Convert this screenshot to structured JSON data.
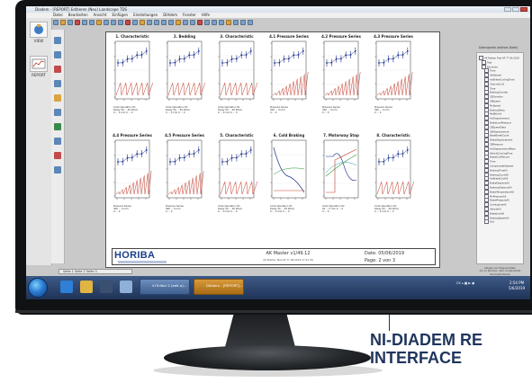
{
  "window": {
    "app_title": "Diadem - [REPORT]   Editieren (Neu)   Landscape TDS",
    "menu": [
      "Datei",
      "Bearbeiten",
      "Ansicht",
      "Einfügen",
      "Einstellungen",
      "DIAdem",
      "Fenster",
      "Hilfe"
    ]
  },
  "left_panel": {
    "view_label": "VIEW",
    "report_label": "REPORT"
  },
  "report": {
    "charts": [
      {
        "title": "1. Characteristic",
        "caption": "Code Operation Hz\nDelay 50 ... 56 kHz/s\n0 ... 0 mm  0 ... 0"
      },
      {
        "title": "2. Bedding",
        "caption": "Code Operation Hz\nDelay 50 ... 56 kHz/s\n0 ... 0 mm  0 ... 0"
      },
      {
        "title": "3. Characteristic",
        "caption": "Code Operation Hz\nDelay 50 ... 56 kHz/s\n0 ... 0 mm  0 ... 0"
      },
      {
        "title": "4.1 Pressure Series",
        "caption": "Pressure Series\n300 ... 0 mm\n0 ... 0"
      },
      {
        "title": "4.2 Pressure Series",
        "caption": "Pressure Series\n300 ... 0 mm\n0 ... 0"
      },
      {
        "title": "4.3 Pressure Series",
        "caption": "Pressure Series\n300 ... 0 mm\n0 ... 0"
      },
      {
        "title": "4.4 Pressure Series",
        "caption": "Pressure Series\n300 ... 0 mm\n0 ... 0"
      },
      {
        "title": "4.5 Pressure Series",
        "caption": "Pressure Series\n300 ... 0 mm\n0 ... 0"
      },
      {
        "title": "5. Characteristic",
        "caption": "Code Operation Hz\nDelay 50 ... 56 kHz/s\n0 ... 0 mm  0 ... 0"
      },
      {
        "title": "6. Cold Braking",
        "caption": "Code Operation Hz\nDelay 50 ... 56 kHz/s\n0 ... 0 mm  0 ... 0"
      },
      {
        "title": "7. Motorway Stop",
        "caption": "Code Operation Hz\n20 ... 0 mm  0 ... 0\n0 ... 0"
      },
      {
        "title": "8. Characteristic",
        "caption": "Code Operation Hz\nDelay 50 ... 56 kHz/s\n0 ... 0 mm  0 ... 0"
      }
    ],
    "footer": {
      "logo": "HORIBA",
      "center_title": "AK Master v1/49.12",
      "center_sub": "AK Master Test AP 77 06.2019 17:21:39",
      "date": "Date: 05/06/2019",
      "page": "Page: 2 von 3"
    },
    "page_tab": "Seite  1  Seite 2  Seite 3"
  },
  "right_panel": {
    "title": "Datenportal (aktives Datei)",
    "tree": [
      "AK Master Test AP 77 06.2019",
      "Test",
      "Kennlinie",
      "Time",
      "VehSpeed",
      "AvlBrakeCoolingTime",
      "Channels 16",
      "Time",
      "BrakingCounter",
      "CBDuration",
      "CBSpeed",
      "PinSpeed",
      "BrakingTemp",
      "PadBrkAct",
      "AvlDisplacement",
      "BrakeLinePressure",
      "CBSpeedData",
      "CBDisplacement",
      "BaseBrakeCount",
      "BrakeDisplacement",
      "CBPressure",
      "AvlDisplacementMean",
      "VehicleCoolingTime",
      "BrakeCoolRecord",
      "Time",
      "CompensatedSpeed",
      "BrakingTimeAll",
      "BrakingCountAll",
      "AvlBrakeCoolAll",
      "BrakeDisplaceAll",
      "BrakingDistanceAll",
      "BrakeTemperatureAll",
      "PinPressureAll",
      "BrakePressureAll",
      "CoolingLineAll",
      "VehicleAll",
      "BrakeLineAll",
      "BrakingSpeedAll",
      "Exit"
    ],
    "note": "Ablegen der Eigenschaften\nder im Struktur- oder Containerfeld\nhervorgehobenen\nEigenschaften"
  },
  "taskbar": {
    "tasks": [
      "VI Editor 2 (edit a)...",
      "DIAdem - [REPORT]..."
    ],
    "tray": "DE  ▴  ■  ▶  ●",
    "time": "2:54 PM",
    "date": "5/6/2019"
  },
  "caption": {
    "line1": "NI-DIADEM RE",
    "line2": "INTERFACE"
  },
  "colors": {
    "blue_curve": "#1c2f8c",
    "red_curve": "#c23a2c",
    "green_curve": "#2f9a3a",
    "caption": "#1f355d"
  }
}
